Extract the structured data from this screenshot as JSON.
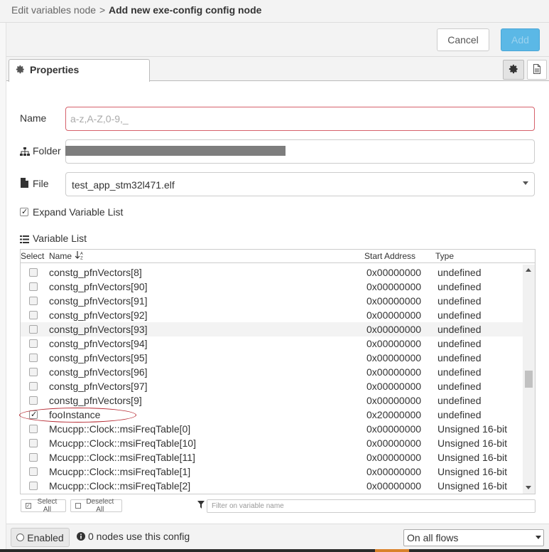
{
  "header": {
    "breadcrumb_parent": "Edit variables node",
    "breadcrumb_sep": ">",
    "breadcrumb_current": "Add new exe-config config node"
  },
  "toolbar": {
    "cancel_label": "Cancel",
    "add_label": "Add"
  },
  "tabs": {
    "properties_label": "Properties"
  },
  "form": {
    "name_label": "Name",
    "name_value": "",
    "name_placeholder": "a-z,A-Z,0-9,_",
    "folder_label": "Folder",
    "file_label": "File",
    "file_value": "test_app_stm32l471.elf",
    "expand_label": "Expand Variable List",
    "expand_checked": true,
    "variable_list_label": "Variable List"
  },
  "table": {
    "headers": {
      "select": "Select",
      "name": "Name",
      "address": "Start Address",
      "type": "Type"
    },
    "rows": [
      {
        "name": "constg_pfnVectors[8]",
        "address": "0x00000000",
        "type": "undefined",
        "checked": false
      },
      {
        "name": "constg_pfnVectors[90]",
        "address": "0x00000000",
        "type": "undefined",
        "checked": false
      },
      {
        "name": "constg_pfnVectors[91]",
        "address": "0x00000000",
        "type": "undefined",
        "checked": false
      },
      {
        "name": "constg_pfnVectors[92]",
        "address": "0x00000000",
        "type": "undefined",
        "checked": false
      },
      {
        "name": "constg_pfnVectors[93]",
        "address": "0x00000000",
        "type": "undefined",
        "checked": false,
        "highlighted": true
      },
      {
        "name": "constg_pfnVectors[94]",
        "address": "0x00000000",
        "type": "undefined",
        "checked": false
      },
      {
        "name": "constg_pfnVectors[95]",
        "address": "0x00000000",
        "type": "undefined",
        "checked": false
      },
      {
        "name": "constg_pfnVectors[96]",
        "address": "0x00000000",
        "type": "undefined",
        "checked": false
      },
      {
        "name": "constg_pfnVectors[97]",
        "address": "0x00000000",
        "type": "undefined",
        "checked": false
      },
      {
        "name": "constg_pfnVectors[9]",
        "address": "0x00000000",
        "type": "undefined",
        "checked": false
      },
      {
        "name": "fooInstance",
        "address": "0x20000000",
        "type": "undefined",
        "checked": true
      },
      {
        "name": "Mcucpp::Clock::msiFreqTable[0]",
        "address": "0x00000000",
        "type": "Unsigned 16-bit",
        "checked": false
      },
      {
        "name": "Mcucpp::Clock::msiFreqTable[10]",
        "address": "0x00000000",
        "type": "Unsigned 16-bit",
        "checked": false
      },
      {
        "name": "Mcucpp::Clock::msiFreqTable[11]",
        "address": "0x00000000",
        "type": "Unsigned 16-bit",
        "checked": false
      },
      {
        "name": "Mcucpp::Clock::msiFreqTable[1]",
        "address": "0x00000000",
        "type": "Unsigned 16-bit",
        "checked": false
      },
      {
        "name": "Mcucpp::Clock::msiFreqTable[2]",
        "address": "0x00000000",
        "type": "Unsigned 16-bit",
        "checked": false
      }
    ]
  },
  "controls": {
    "select_all_label": "Select All",
    "deselect_all_label": "Deselect All",
    "filter_placeholder": "Filter on variable name"
  },
  "footer": {
    "enabled_label": "Enabled",
    "nodes_text": "0 nodes use this config",
    "flows_value": "On all flows"
  },
  "colors": {
    "accent": "#5bb8e6",
    "invalid_border": "#d6616b",
    "annotation": "#b5262f"
  }
}
